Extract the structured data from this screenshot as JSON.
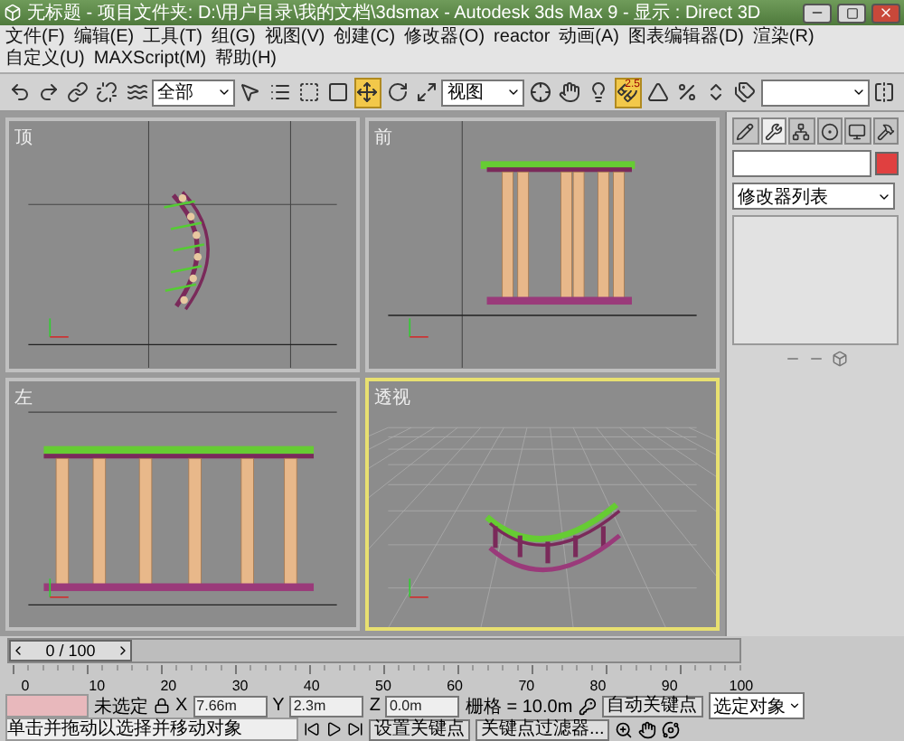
{
  "window": {
    "title": "无标题 - 项目文件夹: D:\\用户目录\\我的文档\\3dsmax - Autodesk 3ds Max 9 - 显示 : Direct 3D"
  },
  "menu": [
    "文件(F)",
    "编辑(E)",
    "工具(T)",
    "组(G)",
    "视图(V)",
    "创建(C)",
    "修改器(O)",
    "reactor",
    "动画(A)",
    "图表编辑器(D)",
    "渲染(R)",
    "自定义(U)",
    "MAXScript(M)",
    "帮助(H)"
  ],
  "toolbar": [
    {
      "kind": "undo",
      "selected": false
    },
    {
      "kind": "redo",
      "selected": false
    },
    {
      "kind": "link",
      "selected": false
    },
    {
      "kind": "unlink",
      "selected": false
    },
    {
      "kind": "bind",
      "selected": false
    },
    {
      "kind": "dropdown",
      "value": "全部"
    },
    {
      "kind": "select",
      "selected": false
    },
    {
      "kind": "select-name",
      "selected": false
    },
    {
      "kind": "region",
      "selected": false
    },
    {
      "kind": "window",
      "selected": false
    },
    {
      "kind": "move",
      "selected": true
    },
    {
      "kind": "rotate",
      "selected": false
    },
    {
      "kind": "scale",
      "selected": false
    },
    {
      "kind": "dropdown",
      "value": "视图"
    },
    {
      "kind": "pivot",
      "selected": false
    },
    {
      "kind": "manipulate",
      "selected": false
    },
    {
      "kind": "light",
      "selected": false
    },
    {
      "kind": "snap",
      "selected": true,
      "badge": "2.5"
    },
    {
      "kind": "angle-snap",
      "selected": false
    },
    {
      "kind": "percent-snap",
      "selected": false
    },
    {
      "kind": "spinner-snap",
      "selected": false
    },
    {
      "kind": "named-sets",
      "selected": false
    },
    {
      "kind": "dropdown"
    },
    {
      "kind": "mirror",
      "selected": false
    }
  ],
  "viewports": [
    {
      "label": "顶",
      "kind": "top",
      "active": false
    },
    {
      "label": "前",
      "kind": "front",
      "active": false
    },
    {
      "label": "左",
      "kind": "left",
      "active": false
    },
    {
      "label": "透视",
      "kind": "perspective",
      "active": true
    }
  ],
  "command_panel": {
    "tabs": [
      {
        "kind": "create",
        "selected": false
      },
      {
        "kind": "modify",
        "selected": true
      },
      {
        "kind": "hierarchy",
        "selected": false
      },
      {
        "kind": "motion",
        "selected": false
      },
      {
        "kind": "display",
        "selected": false
      },
      {
        "kind": "utilities",
        "selected": false
      }
    ],
    "object_swatch": {
      "color": "#e04040"
    },
    "modifier_list": "修改器列表"
  },
  "time_slider": {
    "position": "0 / 100",
    "level": 0
  },
  "track_bar": {
    "ticks": [
      "0",
      "10",
      "20",
      "30",
      "40",
      "50",
      "60",
      "70",
      "80",
      "90",
      "100"
    ]
  },
  "status": {
    "selection": "未选定",
    "coords": [
      {
        "axis": "X",
        "value": "7.66m"
      },
      {
        "axis": "Y",
        "value": "2.3m"
      },
      {
        "axis": "Z",
        "value": "0.0m"
      }
    ],
    "grid": "栅格 = 10.0m",
    "prompt": "单击并拖动以选择并移动对象",
    "auto_key": "自动关键点",
    "key_mode": "选定对象",
    "set_key": "设置关键点",
    "key_filters": "关键点过滤器..."
  }
}
